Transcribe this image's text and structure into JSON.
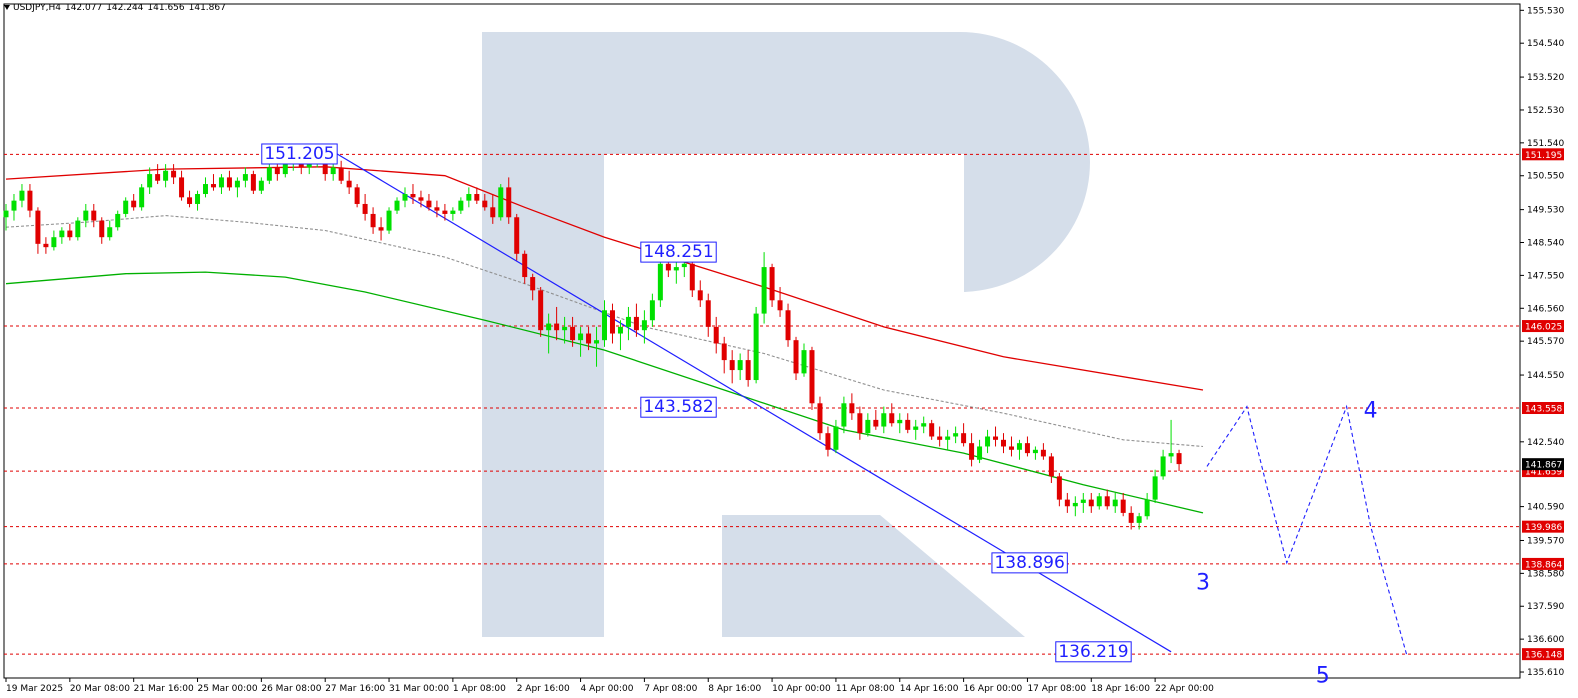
{
  "header": {
    "symbol": "USDJPY,H4",
    "open": "142.077",
    "high": "142.244",
    "low": "141.656",
    "close": "141.867"
  },
  "colors": {
    "bull": "#00e000",
    "bear": "#e00000",
    "level": "#e00000",
    "wave": "#1f1fff",
    "ma_slow": "#e00000",
    "ma_mid": "#909090",
    "ma_fast": "#00b000",
    "watermark": "#d5deea",
    "grid_text": "#000000"
  },
  "chart_data": {
    "type": "line",
    "title": "",
    "y_ticks": [
      "155.530",
      "154.540",
      "153.520",
      "152.530",
      "151.540",
      "150.550",
      "149.530",
      "148.540",
      "147.550",
      "146.560",
      "145.570",
      "144.550",
      "142.540",
      "140.590",
      "139.570",
      "138.580",
      "137.590",
      "136.600",
      "135.610"
    ],
    "ylim": [
      135.43,
      155.72
    ],
    "x_ticks": [
      "19 Mar 2025",
      "20 Mar 08:00",
      "21 Mar 16:00",
      "25 Mar 00:00",
      "26 Mar 08:00",
      "27 Mar 16:00",
      "31 Mar 00:00",
      "1 Apr 08:00",
      "2 Apr 16:00",
      "4 Apr 00:00",
      "7 Apr 08:00",
      "8 Apr 16:00",
      "10 Apr 00:00",
      "11 Apr 08:00",
      "14 Apr 16:00",
      "16 Apr 00:00",
      "17 Apr 08:00",
      "18 Apr 16:00",
      "22 Apr 00:00"
    ],
    "x_tick_index": [
      0,
      8,
      16,
      24,
      32,
      40,
      48,
      56,
      64,
      72,
      80,
      88,
      96,
      104,
      112,
      120,
      128,
      136,
      144
    ],
    "price_levels": [
      {
        "value": 151.195,
        "label": "151.195"
      },
      {
        "value": 146.025,
        "label": "146.025"
      },
      {
        "value": 143.558,
        "label": "143.558"
      },
      {
        "value": 141.659,
        "label": "141.659"
      },
      {
        "value": 139.986,
        "label": "139.986"
      },
      {
        "value": 138.864,
        "label": "138.864"
      },
      {
        "value": 136.148,
        "label": "136.148"
      }
    ],
    "current_price_label": "141.867",
    "current_price": 141.867,
    "annotations": [
      {
        "text": "151.205",
        "bar": 41.5,
        "price": 151.205
      },
      {
        "text": "148.251",
        "bar": 89,
        "price": 148.251
      },
      {
        "text": "143.582",
        "bar": 89,
        "price": 143.582
      },
      {
        "text": "138.896",
        "bar": 133,
        "price": 138.896
      },
      {
        "text": "136.219",
        "bar": 141,
        "price": 136.219
      }
    ],
    "wave_labels": [
      {
        "text": "3",
        "bar": 150,
        "price": 138.4
      },
      {
        "text": "4",
        "bar": 171,
        "price": 143.58
      },
      {
        "text": "5",
        "bar": 165,
        "price": 135.6
      }
    ],
    "forecast_path": [
      [
        150.5,
        141.8
      ],
      [
        155.5,
        143.6
      ],
      [
        158,
        141.2
      ],
      [
        160.5,
        138.9
      ],
      [
        164.5,
        141.4
      ],
      [
        168,
        143.6
      ],
      [
        171,
        140.0
      ],
      [
        175.5,
        136.15
      ]
    ],
    "trendline": [
      [
        41.5,
        151.205
      ],
      [
        146,
        136.219
      ]
    ],
    "ma_slow": [
      [
        0,
        150.45
      ],
      [
        20,
        150.75
      ],
      [
        40,
        150.82
      ],
      [
        55,
        150.55
      ],
      [
        65,
        149.6
      ],
      [
        75,
        148.7
      ],
      [
        85,
        147.95
      ],
      [
        95,
        147.2
      ],
      [
        110,
        146.0
      ],
      [
        125,
        145.1
      ],
      [
        150,
        144.1
      ]
    ],
    "ma_mid": [
      [
        0,
        149.0
      ],
      [
        10,
        149.15
      ],
      [
        20,
        149.35
      ],
      [
        30,
        149.15
      ],
      [
        40,
        148.9
      ],
      [
        55,
        148.1
      ],
      [
        65,
        147.3
      ],
      [
        80,
        146.0
      ],
      [
        95,
        145.2
      ],
      [
        110,
        144.1
      ],
      [
        125,
        143.4
      ],
      [
        140,
        142.6
      ],
      [
        150,
        142.4
      ]
    ],
    "ma_fast": [
      [
        0,
        147.3
      ],
      [
        15,
        147.6
      ],
      [
        25,
        147.65
      ],
      [
        35,
        147.5
      ],
      [
        45,
        147.05
      ],
      [
        60,
        146.2
      ],
      [
        75,
        145.3
      ],
      [
        90,
        144.1
      ],
      [
        105,
        142.9
      ],
      [
        120,
        142.2
      ],
      [
        135,
        141.25
      ],
      [
        150,
        140.4
      ]
    ],
    "candles": [
      [
        149.3,
        149.7,
        148.9,
        149.5
      ],
      [
        149.5,
        150.0,
        149.2,
        149.8
      ],
      [
        149.8,
        150.3,
        149.6,
        150.1
      ],
      [
        150.1,
        150.3,
        149.3,
        149.5
      ],
      [
        149.5,
        149.6,
        148.2,
        148.5
      ],
      [
        148.5,
        148.7,
        148.2,
        148.4
      ],
      [
        148.4,
        148.9,
        148.3,
        148.7
      ],
      [
        148.7,
        149.0,
        148.5,
        148.9
      ],
      [
        148.9,
        149.1,
        148.6,
        148.7
      ],
      [
        148.7,
        149.3,
        148.6,
        149.2
      ],
      [
        149.2,
        149.7,
        149.0,
        149.5
      ],
      [
        149.5,
        149.7,
        149.0,
        149.2
      ],
      [
        149.2,
        149.3,
        148.5,
        148.7
      ],
      [
        148.7,
        149.2,
        148.6,
        149.0
      ],
      [
        149.0,
        149.5,
        148.9,
        149.4
      ],
      [
        149.4,
        149.9,
        149.3,
        149.8
      ],
      [
        149.8,
        150.0,
        149.5,
        149.6
      ],
      [
        149.6,
        150.3,
        149.5,
        150.2
      ],
      [
        150.2,
        150.8,
        150.0,
        150.6
      ],
      [
        150.6,
        150.9,
        150.3,
        150.4
      ],
      [
        150.4,
        150.9,
        150.2,
        150.7
      ],
      [
        150.7,
        150.9,
        150.3,
        150.5
      ],
      [
        150.5,
        150.7,
        149.8,
        149.9
      ],
      [
        149.9,
        150.1,
        149.6,
        149.7
      ],
      [
        149.7,
        150.1,
        149.5,
        150.0
      ],
      [
        150.0,
        150.5,
        149.9,
        150.3
      ],
      [
        150.3,
        150.6,
        150.1,
        150.2
      ],
      [
        150.2,
        150.6,
        150.0,
        150.5
      ],
      [
        150.5,
        150.7,
        150.1,
        150.2
      ],
      [
        150.2,
        150.5,
        149.9,
        150.4
      ],
      [
        150.4,
        150.8,
        150.2,
        150.6
      ],
      [
        150.6,
        150.7,
        150.0,
        150.1
      ],
      [
        150.1,
        150.5,
        150.0,
        150.4
      ],
      [
        150.4,
        150.9,
        150.3,
        150.8
      ],
      [
        150.8,
        151.0,
        150.4,
        150.6
      ],
      [
        150.6,
        151.1,
        150.5,
        150.9
      ],
      [
        150.9,
        151.2,
        150.7,
        151.0
      ],
      [
        151.0,
        151.2,
        150.6,
        150.8
      ],
      [
        150.8,
        151.1,
        150.6,
        151.0
      ],
      [
        151.0,
        151.2,
        150.8,
        151.1
      ],
      [
        151.1,
        151.2,
        150.4,
        150.6
      ],
      [
        150.6,
        150.9,
        150.4,
        150.8
      ],
      [
        150.8,
        151.0,
        150.3,
        150.4
      ],
      [
        150.4,
        150.7,
        150.0,
        150.2
      ],
      [
        150.2,
        150.3,
        149.6,
        149.7
      ],
      [
        149.7,
        150.0,
        149.2,
        149.4
      ],
      [
        149.4,
        149.6,
        148.8,
        149.0
      ],
      [
        149.0,
        149.3,
        148.6,
        148.9
      ],
      [
        148.9,
        149.6,
        148.8,
        149.5
      ],
      [
        149.5,
        149.9,
        149.4,
        149.8
      ],
      [
        149.8,
        150.2,
        149.6,
        150.0
      ],
      [
        150.0,
        150.3,
        149.7,
        149.9
      ],
      [
        149.9,
        150.1,
        149.6,
        149.8
      ],
      [
        149.8,
        150.0,
        149.5,
        149.6
      ],
      [
        149.6,
        149.8,
        149.3,
        149.5
      ],
      [
        149.5,
        149.7,
        149.2,
        149.4
      ],
      [
        149.4,
        149.6,
        149.2,
        149.5
      ],
      [
        149.5,
        149.9,
        149.4,
        149.8
      ],
      [
        149.8,
        150.2,
        149.6,
        150.0
      ],
      [
        150.0,
        150.2,
        149.7,
        149.8
      ],
      [
        149.8,
        150.0,
        149.5,
        149.6
      ],
      [
        149.6,
        150.0,
        149.1,
        149.3
      ],
      [
        149.3,
        150.3,
        149.2,
        150.2
      ],
      [
        150.2,
        150.5,
        149.1,
        149.3
      ],
      [
        149.3,
        149.4,
        148.0,
        148.2
      ],
      [
        148.2,
        148.3,
        147.3,
        147.5
      ],
      [
        147.5,
        147.6,
        146.8,
        147.1
      ],
      [
        147.1,
        147.2,
        145.7,
        145.9
      ],
      [
        145.9,
        146.4,
        145.2,
        146.1
      ],
      [
        146.1,
        146.6,
        145.6,
        145.9
      ],
      [
        145.9,
        146.3,
        145.5,
        146.0
      ],
      [
        146.0,
        146.3,
        145.4,
        145.6
      ],
      [
        145.6,
        146.0,
        145.1,
        145.8
      ],
      [
        145.8,
        146.0,
        145.3,
        145.5
      ],
      [
        145.5,
        146.0,
        144.8,
        145.6
      ],
      [
        145.6,
        146.8,
        145.4,
        146.5
      ],
      [
        146.5,
        146.7,
        145.5,
        145.8
      ],
      [
        145.8,
        146.2,
        145.3,
        146.0
      ],
      [
        146.0,
        146.6,
        145.6,
        146.3
      ],
      [
        146.3,
        146.7,
        145.7,
        145.9
      ],
      [
        145.9,
        146.5,
        145.5,
        146.2
      ],
      [
        146.2,
        147.0,
        146.0,
        146.8
      ],
      [
        146.8,
        148.1,
        146.6,
        147.9
      ],
      [
        147.9,
        148.2,
        147.5,
        147.7
      ],
      [
        147.7,
        148.0,
        147.3,
        147.8
      ],
      [
        147.8,
        148.1,
        147.5,
        147.9
      ],
      [
        147.9,
        148.0,
        146.9,
        147.1
      ],
      [
        147.1,
        147.4,
        146.6,
        146.8
      ],
      [
        146.8,
        147.0,
        145.7,
        146.0
      ],
      [
        146.0,
        146.3,
        145.2,
        145.5
      ],
      [
        145.5,
        145.7,
        144.6,
        145.0
      ],
      [
        145.0,
        145.3,
        144.3,
        144.7
      ],
      [
        144.7,
        145.2,
        144.4,
        145.0
      ],
      [
        145.0,
        145.3,
        144.2,
        144.4
      ],
      [
        144.4,
        146.6,
        144.3,
        146.4
      ],
      [
        146.4,
        148.25,
        146.1,
        147.8
      ],
      [
        147.8,
        147.9,
        146.6,
        146.8
      ],
      [
        146.8,
        147.2,
        146.3,
        146.5
      ],
      [
        146.5,
        146.7,
        145.4,
        145.6
      ],
      [
        145.6,
        145.7,
        144.4,
        144.6
      ],
      [
        144.6,
        145.5,
        144.5,
        145.3
      ],
      [
        145.3,
        145.4,
        143.5,
        143.7
      ],
      [
        143.7,
        143.9,
        142.6,
        142.8
      ],
      [
        142.8,
        143.0,
        142.1,
        142.3
      ],
      [
        142.3,
        143.2,
        142.2,
        143.0
      ],
      [
        143.0,
        143.9,
        142.8,
        143.7
      ],
      [
        143.7,
        144.0,
        143.2,
        143.4
      ],
      [
        143.4,
        143.6,
        142.6,
        142.8
      ],
      [
        142.8,
        143.4,
        142.7,
        143.2
      ],
      [
        143.2,
        143.5,
        142.9,
        143.0
      ],
      [
        143.0,
        143.6,
        142.8,
        143.4
      ],
      [
        143.4,
        143.7,
        143.0,
        143.1
      ],
      [
        143.1,
        143.4,
        142.8,
        143.2
      ],
      [
        143.2,
        143.4,
        142.8,
        142.9
      ],
      [
        142.9,
        143.2,
        142.6,
        143.0
      ],
      [
        143.0,
        143.3,
        142.8,
        143.1
      ],
      [
        143.1,
        143.2,
        142.6,
        142.7
      ],
      [
        142.7,
        143.0,
        142.4,
        142.6
      ],
      [
        142.6,
        142.9,
        142.3,
        142.7
      ],
      [
        142.7,
        143.0,
        142.5,
        142.8
      ],
      [
        142.8,
        143.1,
        142.4,
        142.5
      ],
      [
        142.5,
        142.8,
        141.8,
        142.0
      ],
      [
        142.0,
        142.6,
        141.9,
        142.4
      ],
      [
        142.4,
        142.9,
        142.2,
        142.7
      ],
      [
        142.7,
        143.0,
        142.4,
        142.6
      ],
      [
        142.6,
        142.8,
        142.2,
        142.4
      ],
      [
        142.4,
        142.7,
        142.1,
        142.3
      ],
      [
        142.3,
        142.6,
        142.0,
        142.5
      ],
      [
        142.5,
        142.7,
        142.1,
        142.2
      ],
      [
        142.2,
        142.4,
        142.0,
        142.3
      ],
      [
        142.3,
        142.5,
        142.0,
        142.1
      ],
      [
        142.1,
        142.2,
        141.3,
        141.5
      ],
      [
        141.5,
        141.6,
        140.6,
        140.8
      ],
      [
        140.8,
        141.0,
        140.4,
        140.6
      ],
      [
        140.6,
        140.9,
        140.3,
        140.7
      ],
      [
        140.7,
        141.0,
        140.4,
        140.8
      ],
      [
        140.8,
        141.0,
        140.4,
        140.6
      ],
      [
        140.6,
        141.0,
        140.5,
        140.9
      ],
      [
        140.9,
        141.1,
        140.5,
        140.6
      ],
      [
        140.6,
        141.0,
        140.4,
        140.8
      ],
      [
        140.8,
        141.0,
        140.3,
        140.4
      ],
      [
        140.4,
        140.6,
        139.9,
        140.1
      ],
      [
        140.1,
        140.4,
        139.9,
        140.3
      ],
      [
        140.3,
        141.0,
        140.2,
        140.8
      ],
      [
        140.8,
        141.7,
        140.7,
        141.5
      ],
      [
        141.5,
        142.3,
        141.4,
        142.1
      ],
      [
        142.1,
        143.2,
        141.9,
        142.2
      ],
      [
        142.2,
        142.3,
        141.66,
        141.87
      ]
    ]
  }
}
